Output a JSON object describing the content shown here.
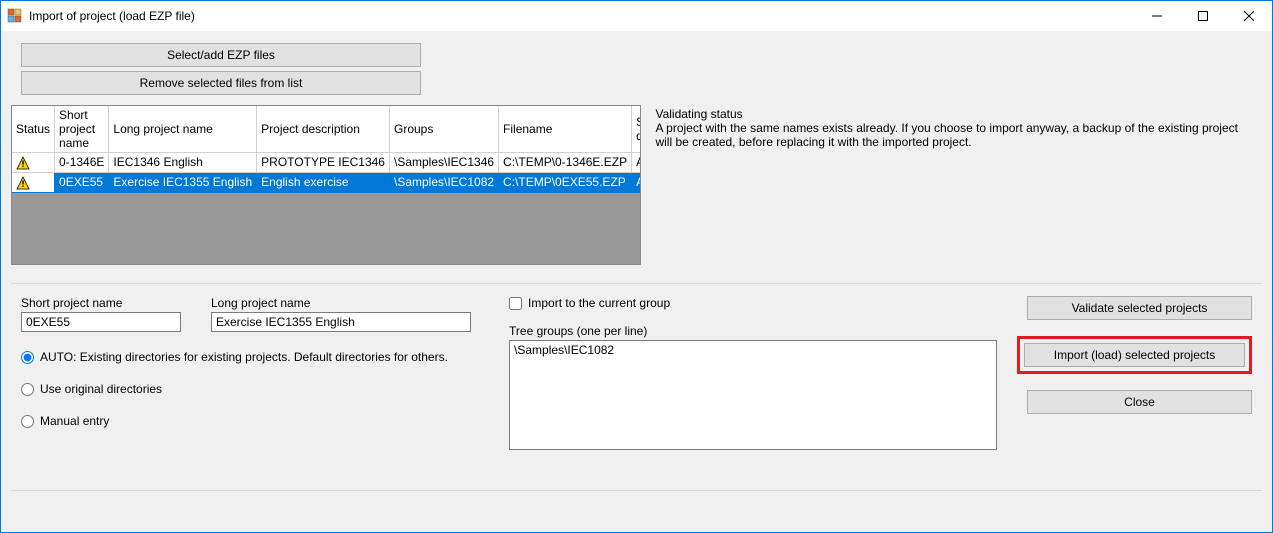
{
  "window": {
    "title": "Import of project (load EZP file)"
  },
  "topbuttons": {
    "select_add": "Select/add EZP files",
    "remove_selected": "Remove selected files from list"
  },
  "grid": {
    "headers": {
      "status": "Status",
      "short": "Short project name",
      "long": "Long project name",
      "desc": "Project description",
      "groups": "Groups",
      "filename": "Filename",
      "source": "SOURCE directory"
    },
    "rows": [
      {
        "status_icon": "warning",
        "short": "0-1346E",
        "long": "IEC1346 English",
        "desc": "PROTOTYPE IEC1346",
        "groups": "\\Samples\\IEC1346",
        "filename": "C:\\TEMP\\0-1346E.EZP",
        "source": "Auto",
        "selected": false
      },
      {
        "status_icon": "warning",
        "short": "0EXE55",
        "long": "Exercise IEC1355 English",
        "desc": "English exercise",
        "groups": "\\Samples\\IEC1082",
        "filename": "C:\\TEMP\\0EXE55.EZP",
        "source": "Auto",
        "selected": true
      }
    ]
  },
  "validating": {
    "title": "Validating status",
    "message": "A project with the same names exists already. If you choose to import anyway, a backup of the existing project will be created, before replacing it with the imported project."
  },
  "form": {
    "short_label": "Short project name",
    "short_value": "0EXE55",
    "long_label": "Long project name",
    "long_value": "Exercise IEC1355 English",
    "radios": {
      "auto": "AUTO: Existing directories for existing projects. Default directories for others.",
      "original": "Use original directories",
      "manual": "Manual entry",
      "selected": "auto"
    },
    "import_current_group": "Import to the current group",
    "tree_label": "Tree groups (one per line)",
    "tree_value": "\\Samples\\IEC1082"
  },
  "actions": {
    "validate": "Validate selected projects",
    "import": "Import (load) selected projects",
    "close": "Close"
  }
}
